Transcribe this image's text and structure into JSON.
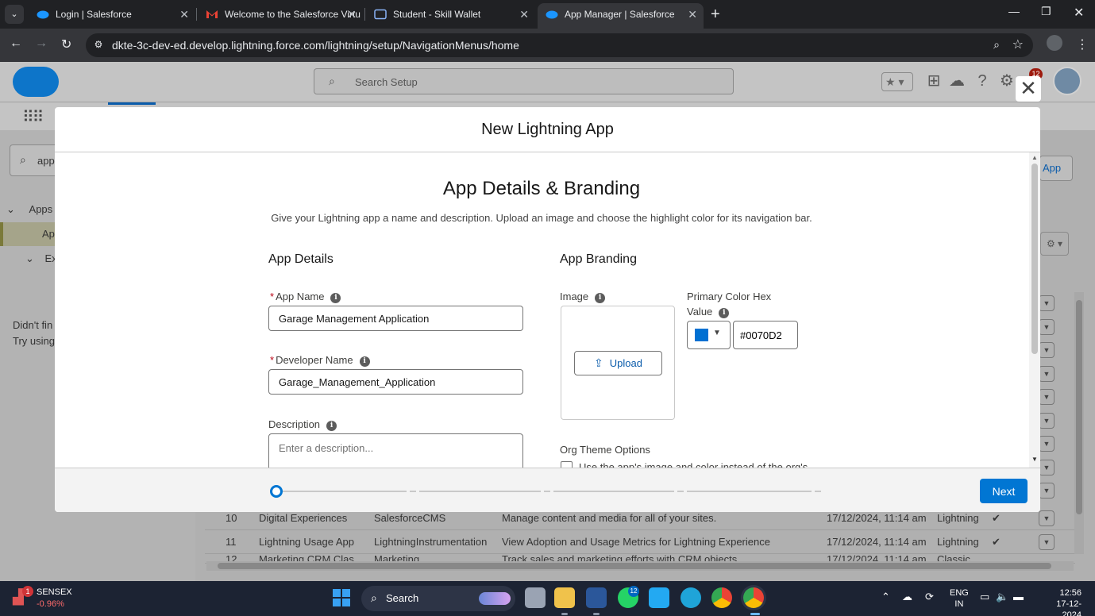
{
  "browser": {
    "tabs": [
      {
        "title": "Login | Salesforce",
        "active": false
      },
      {
        "title": "Welcome to the Salesforce Virtu",
        "active": false
      },
      {
        "title": "Student - Skill Wallet",
        "active": false
      },
      {
        "title": "App Manager | Salesforce",
        "active": true
      }
    ],
    "url": "dkte-3c-dev-ed.develop.lightning.force.com/lightning/setup/NavigationMenus/home",
    "icons": {
      "back": "arrow-left-icon",
      "forward": "arrow-right-icon",
      "reload": "reload-icon",
      "site_info": "tune-icon",
      "zoom": "zoom-icon",
      "bookmark": "star-icon",
      "profile": "profile-icon",
      "menu": "kebab-icon"
    }
  },
  "sf": {
    "search_placeholder": "Search Setup",
    "notification_count": "12",
    "quick_find_value": "app",
    "tree": {
      "apps": "Apps",
      "app_manager_partial": "Ap",
      "extensions_partial": "Ext"
    },
    "hint_line1": "Didn't fin",
    "hint_line2": "Try using",
    "new_app_partial": "App",
    "rows": [
      {
        "num": "10",
        "label": "Digital Experiences",
        "dev": "SalesforceCMS",
        "desc": "Manage content and media for all of your sites.",
        "modified": "17/12/2024, 11:14 am",
        "type": "Lightning"
      },
      {
        "num": "11",
        "label": "Lightning Usage App",
        "dev": "LightningInstrumentation",
        "desc": "View Adoption and Usage Metrics for Lightning Experience",
        "modified": "17/12/2024, 11:14 am",
        "type": "Lightning"
      },
      {
        "num": "12",
        "label": "Marketing CRM Clas",
        "dev": "Marketing",
        "desc": "Track sales and marketing efforts with CRM objects.",
        "modified": "17/12/2024, 11:14 am",
        "type": "Classic"
      }
    ]
  },
  "modal": {
    "title": "New Lightning App",
    "close_icon": "close-icon",
    "step_title": "App Details & Branding",
    "step_description": "Give your Lightning app a name and description. Upload an image and choose the highlight color for its navigation bar.",
    "details_heading": "App Details",
    "branding_heading": "App Branding",
    "app_name_label": "App Name",
    "app_name_value": "Garage Management Application",
    "developer_name_label": "Developer Name",
    "developer_name_value": "Garage_Management_Application",
    "description_label": "Description",
    "description_placeholder": "Enter a description...",
    "image_label": "Image",
    "upload_label": "Upload",
    "primary_color_label_1": "Primary Color Hex",
    "primary_color_label_2": "Value",
    "primary_color_value": "#0070D2",
    "org_theme_label": "Org Theme Options",
    "org_theme_checkbox_label": "Use the app's image and color instead of the org's",
    "next_label": "Next",
    "progress": {
      "current_step": 1,
      "total_steps": 5
    }
  },
  "colors": {
    "brand": "#0176d3",
    "primary_swatch": "#0070D2",
    "required": "#ba0517"
  },
  "taskbar": {
    "stock_name": "SENSEX",
    "stock_change": "-0.96%",
    "stock_badge": "1",
    "search_label": "Search",
    "whatsapp_badge": "12",
    "lang_1": "ENG",
    "lang_2": "IN",
    "time": "12:56",
    "date": "17-12-2024"
  }
}
